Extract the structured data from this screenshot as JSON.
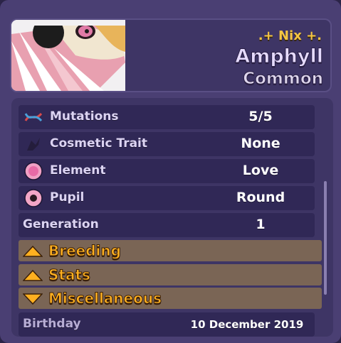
{
  "header": {
    "nickname": ".+ Nix +.",
    "species": "Amphyll",
    "rarity": "Common"
  },
  "rows": [
    {
      "label": "Mutations",
      "value": "5/5",
      "icon": "dna-icon"
    },
    {
      "label": "Cosmetic Trait",
      "value": "None",
      "icon": "cosmetic-icon"
    },
    {
      "label": "Element",
      "value": "Love",
      "icon": "love-element-icon"
    },
    {
      "label": "Pupil",
      "value": "Round",
      "icon": "round-pupil-icon"
    },
    {
      "label": "Generation",
      "value": "1"
    }
  ],
  "sections": [
    {
      "title": "Breeding",
      "state": "collapsed"
    },
    {
      "title": "Stats",
      "state": "collapsed"
    },
    {
      "title": "Miscellaneous",
      "state": "expanded"
    }
  ],
  "misc": {
    "birthday_label": "Birthday",
    "birthday_value": "10 December 2019"
  },
  "colors": {
    "panel": "#4a3f73",
    "row": "#302856",
    "section": "#7a6555",
    "section_title": "#ffb020",
    "nickname": "#f5c542"
  }
}
